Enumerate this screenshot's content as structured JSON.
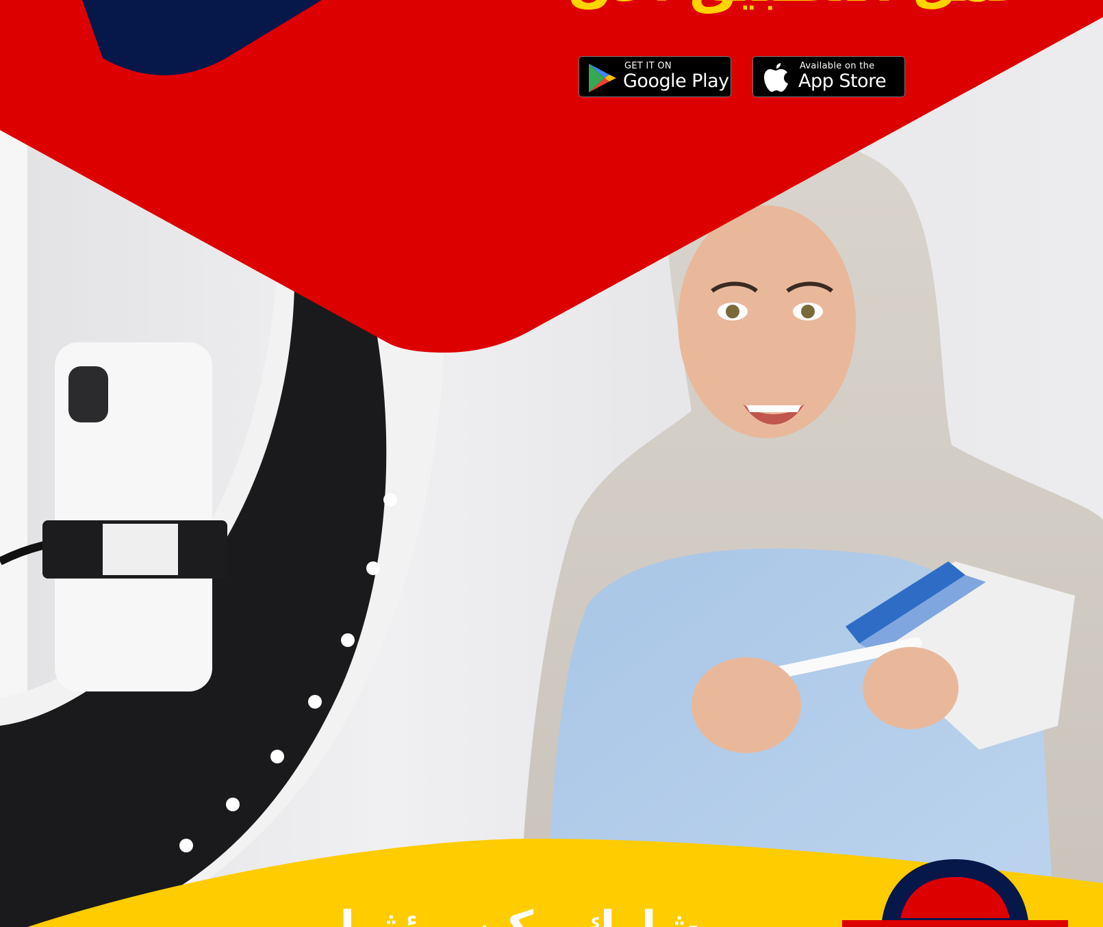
{
  "poster": {
    "headline": "حمل التطبيق الآن",
    "footer_text": "شارك وكن مؤثرا"
  },
  "badges": {
    "google_play": {
      "small": "GET IT ON",
      "big": "Google Play"
    },
    "app_store": {
      "small": "Available on the",
      "big": "App Store"
    }
  },
  "colors": {
    "red": "#dd0000",
    "navy": "#06174a",
    "yellow": "#ffcc00",
    "badge_black": "#000000"
  },
  "icons": [
    "google-play-icon",
    "apple-icon"
  ]
}
